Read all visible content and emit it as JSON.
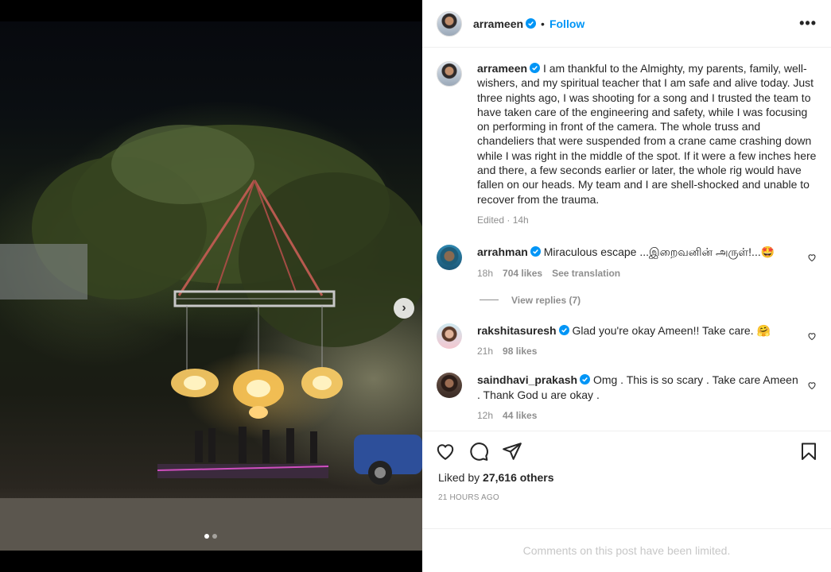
{
  "post": {
    "author": "arrameen",
    "follow_label": "Follow",
    "separator": "•",
    "more_label": "•••"
  },
  "caption": {
    "username": "arrameen",
    "text": "I am thankful to the Almighty, my parents, family, well-wishers, and my spiritual teacher that I am safe and alive today. Just three nights ago, I was shooting for a song and I trusted the team to have taken care of the engineering and safety, while I was focusing on performing in front of the camera. The whole truss and chandeliers that were suspended from a crane came crashing down while I was right in the middle of the spot. If it were a few inches here and there, a few seconds earlier or later, the whole rig would have fallen on our heads. My team and I are shell-shocked and unable to recover from the trauma.",
    "edited": "Edited · 14h"
  },
  "comments": [
    {
      "username": "arrahman",
      "text": "Miraculous escape ...இறைவனின் அருள்!...🤩",
      "time": "18h",
      "likes": "704 likes",
      "translate": "See translation",
      "view_replies": "View replies (7)"
    },
    {
      "username": "rakshitasuresh",
      "text": "Glad you're okay Ameen!! Take care. 🤗",
      "time": "21h",
      "likes": "98 likes"
    },
    {
      "username": "saindhavi_prakash",
      "text": "Omg . This is so scary . Take care Ameen . Thank God u are okay .",
      "time": "12h",
      "likes": "44 likes"
    }
  ],
  "actions": {
    "liked_by_prefix": "Liked by",
    "likes_count": "27,616 others",
    "time_ago": "21 HOURS AGO"
  },
  "footer": {
    "limited_text": "Comments on this post have been limited."
  },
  "carousel": {
    "slide_count": 2,
    "active_index": 0,
    "next_arrow": "›"
  },
  "colors": {
    "accent": "#0095f6",
    "verified": "#0095f6",
    "muted": "#8e8e8e"
  }
}
